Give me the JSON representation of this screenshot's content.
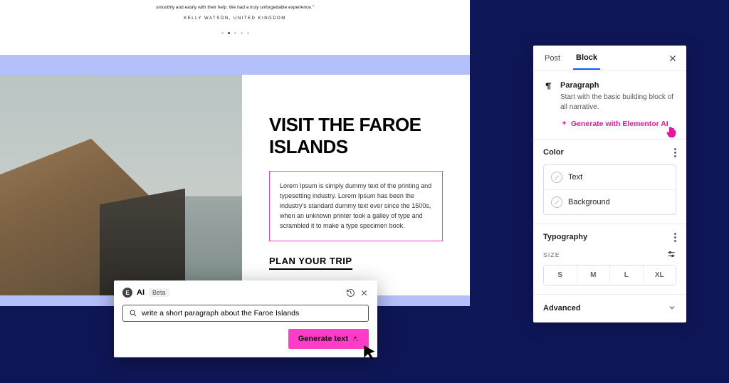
{
  "testimonial": {
    "line": "smoothly and easily with their help. We had a truly unforgettable experience.\"",
    "author": "KELLY WATSON, UNITED KINGDOM"
  },
  "hero": {
    "title": "VISIT THE FAROE ISLANDS",
    "lorem": "Lorem Ipsum is simply dummy text of the printing and typesetting industry. Lorem Ipsum has been the industry's standard dummy text ever since the 1500s, when an unknown printer took a galley of type and scrambled it to make a type specimen book.",
    "cta": "PLAN YOUR TRIP"
  },
  "ai": {
    "label": "AI",
    "beta": "Beta",
    "input": "write a short paragraph about the Faroe Islands",
    "generate": "Generate text"
  },
  "panel": {
    "tabs": {
      "post": "Post",
      "block": "Block"
    },
    "block": {
      "name": "Paragraph",
      "desc": "Start with the basic building block of all narrative.",
      "ai_link": "Generate with Elementor AI"
    },
    "color": {
      "title": "Color",
      "opt_text": "Text",
      "opt_bg": "Background"
    },
    "typo": {
      "title": "Typography",
      "size_label": "SIZE",
      "sizes": [
        "S",
        "M",
        "L",
        "XL"
      ]
    },
    "advanced": "Advanced"
  }
}
